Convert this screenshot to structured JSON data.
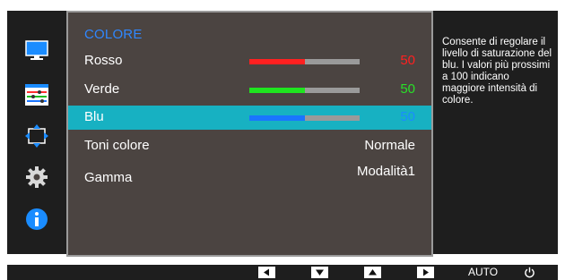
{
  "osd": {
    "title": "COLORE",
    "items": [
      {
        "label": "Rosso",
        "value": "50",
        "level": 0.5,
        "bar_color": "#ff2020",
        "value_color": "#ff2020"
      },
      {
        "label": "Verde",
        "value": "50",
        "level": 0.5,
        "bar_color": "#1fe51f",
        "value_color": "#28e028"
      },
      {
        "label": "Blu",
        "value": "50",
        "level": 0.5,
        "bar_color": "#1a75ff",
        "value_color": "#1a8cff",
        "selected": true
      },
      {
        "label": "Toni colore",
        "value": "Normale"
      },
      {
        "label": "Gamma",
        "value": "Modalità1"
      }
    ]
  },
  "help": {
    "text": "Consente di regolare il livello di saturazione del blu. I valori più prossimi a 100 indicano maggiore intensità di colore."
  },
  "sidebar": {
    "icons": [
      "picture-icon",
      "color-adjust-icon",
      "size-position-icon",
      "settings-gear-icon",
      "information-icon"
    ]
  },
  "bottom_bar": {
    "keys": [
      "left-arrow-key",
      "down-arrow-key",
      "up-arrow-key",
      "right-arrow-key"
    ],
    "auto_label": "AUTO",
    "power_icon": "power-icon"
  },
  "colors": {
    "selected_row": "#17b1c2",
    "title": "#2f87ff",
    "panel": "#4b4441",
    "frame": "#1e1e1e"
  }
}
